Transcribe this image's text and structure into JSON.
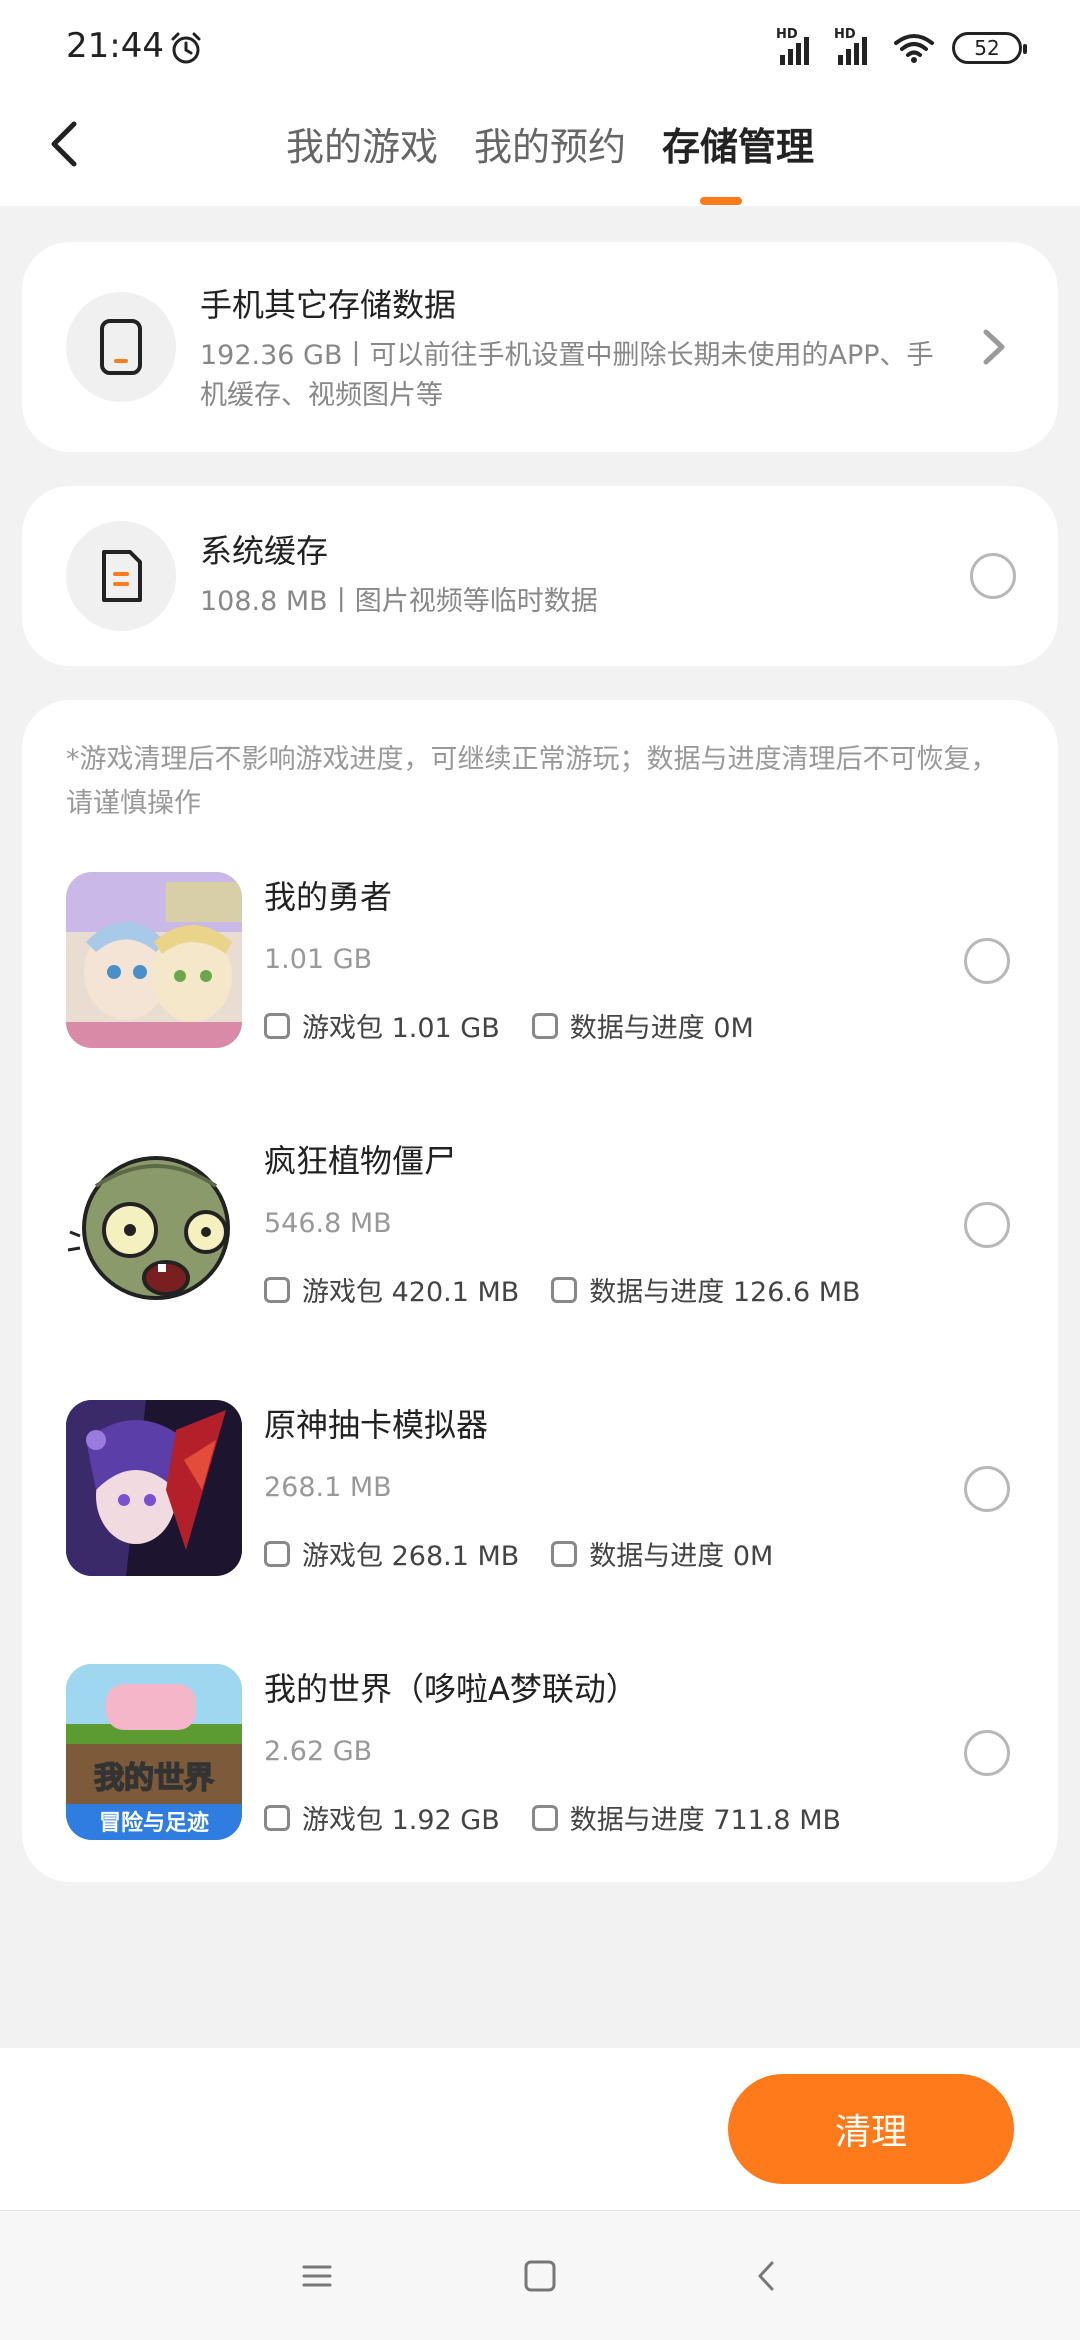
{
  "status_bar": {
    "time": "21:44",
    "signal_label_1": "HD",
    "signal_label_2": "HD",
    "battery": "52"
  },
  "nav": {
    "tabs": [
      {
        "label": "我的游戏",
        "active": false
      },
      {
        "label": "我的预约",
        "active": false
      },
      {
        "label": "存储管理",
        "active": true
      }
    ]
  },
  "other_storage": {
    "title": "手机其它存储数据",
    "subtitle": "192.36 GB丨可以前往手机设置中删除长期未使用的APP、手机缓存、视频图片等"
  },
  "system_cache": {
    "title": "系统缓存",
    "subtitle": "108.8 MB丨图片视频等临时数据"
  },
  "games_section": {
    "note": "*游戏清理后不影响游戏进度，可继续正常游玩；数据与进度清理后不可恢复，请谨慎操作",
    "games": [
      {
        "name": "我的勇者",
        "size": "1.01 GB",
        "package": "游戏包 1.01 GB",
        "data": "数据与进度 0M"
      },
      {
        "name": "疯狂植物僵尸",
        "size": "546.8 MB",
        "package": "游戏包 420.1 MB",
        "data": "数据与进度 126.6 MB"
      },
      {
        "name": "原神抽卡模拟器",
        "size": "268.1 MB",
        "package": "游戏包 268.1 MB",
        "data": "数据与进度 0M"
      },
      {
        "name": "我的世界（哆啦A梦联动）",
        "size": "2.62 GB",
        "package": "游戏包 1.92 GB",
        "data": "数据与进度 711.8 MB",
        "icon_text_top": "我的世界",
        "icon_text_bottom": "冒险与足迹"
      }
    ]
  },
  "actions": {
    "clean_label": "清理"
  },
  "colors": {
    "accent": "#ff7a1a",
    "background": "#f2f2f2",
    "card": "#ffffff"
  }
}
